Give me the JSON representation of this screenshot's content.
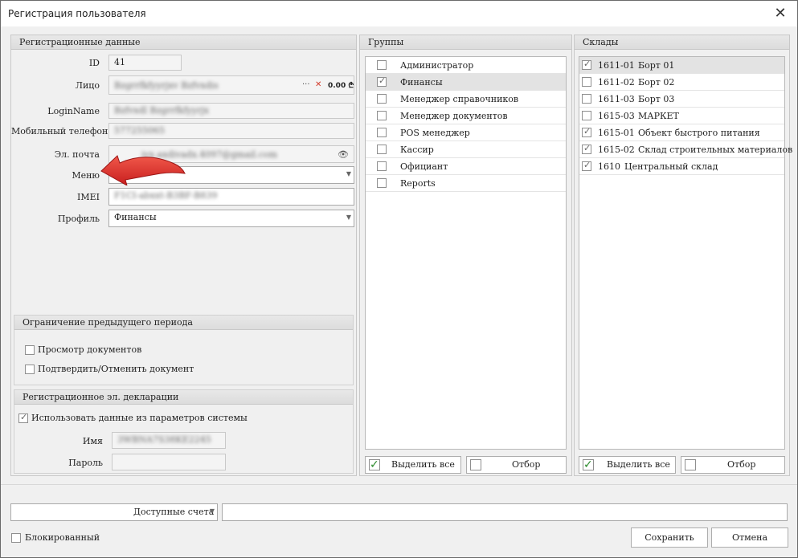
{
  "window": {
    "title": "Регистрация пользователя"
  },
  "registration": {
    "header": "Регистрационные данные",
    "id_label": "ID",
    "id_value": "41",
    "person_label": "Лицо",
    "person_value": "Bzgrrfkfyyrjxv Bzfvxdis",
    "person_amount": "0.00 ₾",
    "login_label": "LoginName",
    "login_value": "Bzfvxdl Bzgrrfkfyyrjx",
    "phone_label": "Мобильный телефон",
    "phone_value": "577255065",
    "email_label": "Эл. почта",
    "email_value": "ivx.axdivadx.4097@gmail.com",
    "menu_label": "Меню",
    "menu_value": "",
    "imei_label": "IMEI",
    "imei_value": "F1CI-abxxt-B3BF-B839",
    "profile_label": "Профиль",
    "profile_value": "Финансы"
  },
  "restriction": {
    "header": "Ограничение предыдущего периода",
    "view_docs": "Просмотр документов",
    "confirm_docs": "Подтвердить/Отменить документ"
  },
  "declaration": {
    "header": "Регистрационное эл. декларации",
    "use_system": "Использовать данные из параметров системы",
    "name_label": "Имя",
    "name_value": "3WBNA7S38KE2245",
    "password_label": "Пароль",
    "password_value": ""
  },
  "groups": {
    "header": "Группы",
    "items": [
      {
        "label": "Администратор",
        "checked": false
      },
      {
        "label": "Финансы",
        "checked": true
      },
      {
        "label": "Менеджер справочников",
        "checked": false
      },
      {
        "label": "Менеджер документов",
        "checked": false
      },
      {
        "label": "POS менеджер",
        "checked": false
      },
      {
        "label": "Кассир",
        "checked": false
      },
      {
        "label": "Официант",
        "checked": false
      },
      {
        "label": "Reports",
        "checked": false
      }
    ],
    "select_all": "Выделить все",
    "filter": "Отбор"
  },
  "warehouses": {
    "header": "Склады",
    "items": [
      {
        "code": "1611-01",
        "name": "Борт 01",
        "checked": true
      },
      {
        "code": "1611-02",
        "name": "Борт 02",
        "checked": false
      },
      {
        "code": "1611-03",
        "name": "Борт 03",
        "checked": false
      },
      {
        "code": "1615-03",
        "name": "МАРКЕТ",
        "checked": false
      },
      {
        "code": "1615-01",
        "name": "Объект быстрого питания",
        "checked": true
      },
      {
        "code": "1615-02",
        "name": "Склад строительных материалов",
        "checked": true
      },
      {
        "code": "1610",
        "name": "Центральный склад",
        "checked": true
      }
    ],
    "select_all": "Выделить все",
    "filter": "Отбор"
  },
  "bottom": {
    "accounts_label": "Доступные счета",
    "accounts_value": "",
    "blocked": "Блокированный",
    "save": "Сохранить",
    "cancel": "Отмена"
  },
  "colors": {
    "arrow": "#e8352a",
    "check_green": "#2a8a2a",
    "close_x": "#d23b2a"
  }
}
